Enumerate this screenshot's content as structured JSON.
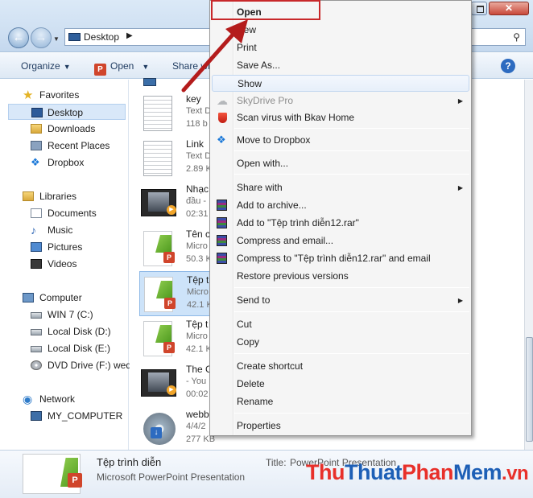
{
  "address": {
    "location": "Desktop"
  },
  "toolbar": {
    "organize": "Organize",
    "open": "Open",
    "share": "Share with"
  },
  "navpane": {
    "favorites_header": "Favorites",
    "favorites": [
      "Desktop",
      "Downloads",
      "Recent Places",
      "Dropbox"
    ],
    "libraries_header": "Libraries",
    "libraries": [
      "Documents",
      "Music",
      "Pictures",
      "Videos"
    ],
    "computer_header": "Computer",
    "drives": [
      "WIN 7 (C:)",
      "Local Disk (D:)",
      "Local Disk (E:)",
      "DVD Drive (F:) wed"
    ],
    "network_header": "Network",
    "network": [
      "MY_COMPUTER"
    ]
  },
  "files": [
    {
      "name": "key",
      "type": "Text D",
      "size": "118 b"
    },
    {
      "name": "Link",
      "type": "Text D",
      "size": "2.89 K"
    },
    {
      "name": "Nhạc",
      "type": "đầu -",
      "size": "02:31"
    },
    {
      "name": "Tên c",
      "type": "Micro",
      "size": "50.3 K"
    },
    {
      "name": "Tệp t",
      "type": "Micro",
      "size": "42.1 K"
    },
    {
      "name": "Tệp t",
      "type": "Micro",
      "size": "42.1 K"
    },
    {
      "name": "The G",
      "type": "- You",
      "size": "00:02"
    },
    {
      "name": "webb",
      "type": "4/4/2",
      "size": "277 KB"
    }
  ],
  "context_menu": {
    "open": "Open",
    "new": "New",
    "print": "Print",
    "save_as": "Save As...",
    "show": "Show",
    "skydrive": "SkyDrive Pro",
    "scan": "Scan virus with Bkav Home",
    "dropbox": "Move to Dropbox",
    "open_with": "Open with...",
    "share_with": "Share with",
    "add_archive": "Add to archive...",
    "add_rar": "Add to \"Tệp trình diễn12.rar\"",
    "compress_email": "Compress and email...",
    "compress_rar_email": "Compress to \"Tệp trình diễn12.rar\" and email",
    "restore": "Restore previous versions",
    "send_to": "Send to",
    "cut": "Cut",
    "copy": "Copy",
    "create_shortcut": "Create shortcut",
    "delete": "Delete",
    "rename": "Rename",
    "properties": "Properties"
  },
  "details": {
    "name": "Tệp trình diễn",
    "type": "Microsoft PowerPoint Presentation",
    "title_label": "Title:",
    "title_value": "PowerPoint Presentation"
  },
  "watermark": {
    "part1": "Thu",
    "part2": "Thuat",
    "part3": "Phan",
    "part4": "Mem",
    "part5": ".vn"
  },
  "colors": {
    "highlight_box": "#c8282a",
    "arrow": "#b41c1c",
    "selection": "#cde3f9"
  }
}
